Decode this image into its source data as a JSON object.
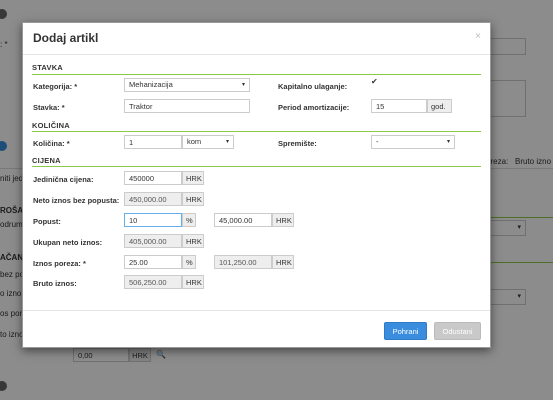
{
  "background": {
    "label_top_left": ": *",
    "label_jed": "niti jed",
    "label_prosa": "ROŠA",
    "label_podrum": "odrum",
    "label_racan": "AČAN",
    "label_bez_po": "bez po",
    "label_no_izno": "o izno",
    "label_os_por": "os por",
    "label_to_izno": "to izno",
    "header_poreza": "oreza:",
    "header_bruto": "Bruto izno",
    "bottom_value": "0,00",
    "bottom_currency": "HRK",
    "bottom_search_icon": "search-plus-icon"
  },
  "modal": {
    "title": "Dodaj artikl",
    "close_symbol": "×",
    "sections": {
      "stavka": "STAVKA",
      "kolicina": "KOLIČINA",
      "cijena": "CIJENA"
    },
    "stavka": {
      "kategorija_label": "Kategorija: *",
      "kategorija_value": "Mehanizacija",
      "stavka_label": "Stavka: *",
      "stavka_value": "Traktor",
      "kapitalno_label": "Kapitalno ulaganje:",
      "kapitalno_checked": "✔",
      "period_label": "Period amortizacije:",
      "period_value": "15",
      "period_unit": "god."
    },
    "kolicina": {
      "kolicina_label": "Količina: *",
      "kolicina_value": "1",
      "unit_value": "kom",
      "spremiste_label": "Spremište:",
      "spremiste_value": "-"
    },
    "cijena": {
      "jedinicna_label": "Jedinična cijena:",
      "jedinicna_value": "450000",
      "jedinicna_currency": "HRK",
      "neto_bez_label": "Neto iznos bez popusta:",
      "neto_bez_value": "450,000.00",
      "neto_bez_currency": "HRK",
      "popust_label": "Popust:",
      "popust_value": "10",
      "popust_unit": "%",
      "popust_amount": "45,000.00",
      "popust_currency": "HRK",
      "ukupan_label": "Ukupan neto iznos:",
      "ukupan_value": "405,000.00",
      "ukupan_currency": "HRK",
      "porez_label": "Iznos poreza: *",
      "porez_value": "25.00",
      "porez_unit": "%",
      "porez_amount": "101,250.00",
      "porez_currency": "HRK",
      "bruto_label": "Bruto iznos:",
      "bruto_value": "506,250.00",
      "bruto_currency": "HRK"
    },
    "footer": {
      "save_label": "Pohrani",
      "cancel_label": "Odustani"
    },
    "colors": {
      "section_line": "#8cc84b",
      "primary": "#3a8dde"
    }
  }
}
